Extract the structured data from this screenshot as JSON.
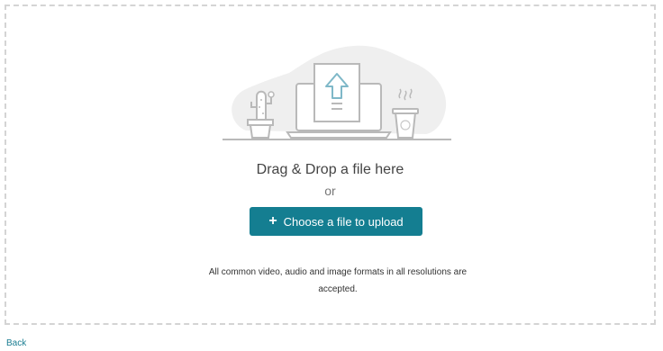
{
  "upload": {
    "heading": "Drag & Drop a file here",
    "or_text": "or",
    "button_label": "Choose a file to upload",
    "note": "All common video, audio and image formats in all resolutions are accepted."
  },
  "nav": {
    "back_label": "Back"
  },
  "icons": {
    "illustration": "upload-laptop-illustration",
    "button_icon": "plus-icon"
  },
  "colors": {
    "accent": "#147e91",
    "link": "#1a7d92",
    "dashed_border": "#d4d4d4"
  }
}
